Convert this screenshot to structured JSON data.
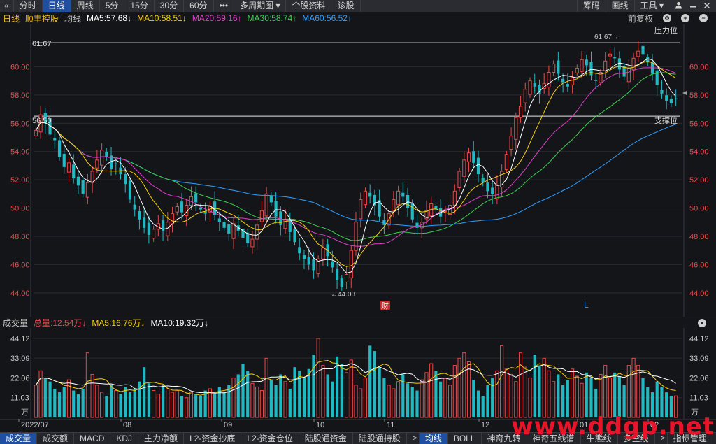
{
  "toolbar": {
    "back_icon": "double-chevron-left",
    "items": [
      "分时",
      "日线",
      "周线",
      "5分",
      "15分",
      "30分",
      "60分",
      "•••",
      "多周期图 ▾",
      "个股资料",
      "诊股"
    ],
    "active_index": 1,
    "right_items": [
      "筹码",
      "画线",
      "工具 ▾"
    ],
    "user_icon": "person-icon",
    "window_icons": [
      "minimize-icon",
      "close-icon"
    ]
  },
  "infobar": {
    "period": "日线",
    "stock_name": "顺丰控股",
    "ma_label": "均线",
    "ma5": "MA5:57.68↓",
    "ma10": "MA10:58.51↓",
    "ma20": "MA20:59.16↑",
    "ma30": "MA30:58.74↑",
    "ma60": "MA60:56.52↑",
    "adjust": "前复权",
    "colors": {
      "ma5": "#ffffff",
      "ma10": "#f5d000",
      "ma20": "#e040c8",
      "ma30": "#3cd050",
      "ma60": "#2ea0ff"
    }
  },
  "price_chart": {
    "y_ticks": [
      "60.00",
      "58.00",
      "56.00",
      "54.00",
      "52.00",
      "50.00",
      "48.00",
      "46.00",
      "44.00"
    ],
    "resistance_label": "压力位",
    "support_label": "支撑位",
    "high_label": "61.67",
    "high_marker": "61.67→",
    "support_value": "56.50",
    "low_marker": "←44.03",
    "event_badge": "财",
    "event_marker": "L"
  },
  "volume": {
    "title": "成交量",
    "total": "总量:12.54万↓",
    "ma5": "MA5:16.76万↓",
    "ma10": "MA10:19.32万↓",
    "y_ticks": [
      "44.12",
      "33.09",
      "22.06",
      "11.03"
    ],
    "unit": "万"
  },
  "x_axis": [
    "2022/07",
    "08",
    "09",
    "10",
    "11",
    "12",
    "01",
    "02"
  ],
  "bottom_tabs": [
    "成交量",
    "成交额",
    "MACD",
    "KDJ",
    "主力净额",
    "L2-资金抄底",
    "L2-资金仓位",
    "陆股通资金",
    "陆股通持股",
    ">",
    "均线",
    "BOLL",
    "神奇九转",
    "神奇五线谱",
    "牛熊线",
    "多空线",
    ">",
    "指标管理"
  ],
  "bottom_active": [
    0,
    10
  ],
  "watermark": "www.ddgp.net",
  "chart_data": {
    "type": "candlestick",
    "symbol": "顺丰控股",
    "period": "daily",
    "ylim": [
      43.2,
      62.0
    ],
    "x": [
      "2022/07",
      "08",
      "09",
      "10",
      "11",
      "12",
      "01",
      "02"
    ],
    "closes": [
      55.5,
      56.6,
      56.0,
      55.2,
      54.8,
      53.6,
      52.9,
      53.2,
      52.1,
      51.6,
      51.0,
      51.8,
      52.6,
      53.4,
      54.1,
      53.6,
      52.8,
      53.1,
      52.4,
      51.7,
      50.6,
      49.9,
      49.2,
      48.6,
      48.1,
      48.5,
      48.9,
      48.4,
      49.0,
      49.6,
      50.1,
      49.7,
      50.2,
      50.8,
      50.4,
      49.9,
      49.6,
      50.1,
      49.5,
      49.0,
      48.6,
      48.2,
      48.9,
      48.4,
      47.9,
      47.5,
      47.8,
      48.8,
      49.8,
      51.0,
      50.4,
      49.4,
      48.8,
      49.2,
      48.3,
      47.6,
      46.8,
      46.4,
      46.0,
      45.6,
      46.4,
      47.2,
      46.6,
      45.8,
      44.9,
      44.4,
      45.3,
      47.0,
      49.0,
      50.6,
      51.2,
      50.8,
      50.2,
      49.4,
      48.8,
      49.6,
      50.6,
      51.2,
      50.8,
      50.0,
      49.2,
      48.6,
      49.0,
      49.8,
      50.3,
      49.9,
      49.4,
      49.8,
      50.2,
      51.2,
      52.6,
      53.4,
      53.9,
      53.2,
      52.4,
      51.8,
      51.2,
      51.0,
      51.6,
      52.6,
      53.8,
      55.1,
      56.4,
      57.2,
      58.4,
      59.0,
      58.6,
      58.1,
      58.8,
      59.6,
      60.2,
      59.5,
      58.9,
      58.6,
      59.2,
      59.9,
      60.5,
      60.1,
      59.4,
      59.0,
      59.6,
      60.4,
      60.9,
      60.6,
      59.8,
      59.3,
      59.9,
      60.6,
      61.1,
      60.9,
      60.3,
      59.5,
      58.7,
      58.1,
      57.6,
      57.4,
      57.7
    ],
    "high": 61.67,
    "low": 44.03,
    "support_level": 56.5,
    "resistance_level": 61.7,
    "ma_values_last": {
      "MA5": 57.68,
      "MA10": 58.51,
      "MA20": 59.16,
      "MA30": 58.74,
      "MA60": 56.52
    },
    "volume_ylim": [
      0,
      46
    ],
    "volumes": [
      18,
      26,
      22,
      20,
      16,
      14,
      17,
      21,
      15,
      13,
      16,
      36,
      24,
      18,
      14,
      12,
      18,
      15,
      13,
      17,
      14,
      16,
      20,
      28,
      19,
      15,
      13,
      18,
      16,
      14,
      15,
      12,
      11,
      14,
      13,
      12,
      15,
      16,
      13,
      17,
      14,
      18,
      22,
      24,
      30,
      26,
      19,
      17,
      15,
      33,
      21,
      18,
      24,
      20,
      16,
      28,
      26,
      22,
      27,
      35,
      44,
      29,
      24,
      20,
      34,
      30,
      25,
      32,
      18,
      16,
      22,
      40,
      37,
      28,
      22,
      18,
      16,
      20,
      24,
      19,
      17,
      15,
      21,
      25,
      30,
      26,
      20,
      22,
      18,
      29,
      33,
      36,
      31,
      21,
      15,
      12,
      18,
      22,
      26,
      40,
      27,
      24,
      20,
      36,
      28,
      22,
      35,
      29,
      33,
      26,
      20,
      24,
      18,
      21,
      27,
      23,
      19,
      25,
      22,
      16,
      24,
      29,
      22,
      25,
      23,
      18,
      29,
      33,
      29,
      22,
      17,
      14,
      20,
      17,
      14,
      12,
      12
    ],
    "volume_ma_last": {
      "MA5": 16.76,
      "MA10": 19.32
    },
    "volume_unit": "万"
  }
}
